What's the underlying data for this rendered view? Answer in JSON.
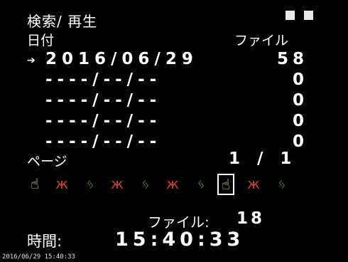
{
  "header": {
    "title": "検索/ 再生"
  },
  "window_controls": [
    "square-button",
    "square-button"
  ],
  "table": {
    "date_header": "日付",
    "file_header": "ファイル",
    "rows": [
      {
        "date": "2016/06/29",
        "count": "58",
        "selected": true
      },
      {
        "date": "----/--/--",
        "count": "0",
        "selected": false
      },
      {
        "date": "----/--/--",
        "count": "0",
        "selected": false
      },
      {
        "date": "----/--/--",
        "count": "0",
        "selected": false
      },
      {
        "date": "----/--/--",
        "count": "0",
        "selected": false
      }
    ],
    "selector_icon": "arrow-cursor-icon"
  },
  "pagination": {
    "label": "ページ",
    "value": "1 / 1"
  },
  "thumbnails": [
    {
      "icon": "hand-pointer-icon",
      "selected": false
    },
    {
      "icon": "butterfly-icon",
      "selected": false
    },
    {
      "icon": "figure-icon",
      "selected": false
    },
    {
      "icon": "butterfly-icon",
      "selected": false
    },
    {
      "icon": "figure-icon",
      "selected": false
    },
    {
      "icon": "butterfly-icon",
      "selected": false
    },
    {
      "icon": "figure-icon",
      "selected": false
    },
    {
      "icon": "hand-pointer-icon",
      "selected": true
    },
    {
      "icon": "butterfly-icon",
      "selected": false
    },
    {
      "icon": "figure-icon",
      "selected": false
    }
  ],
  "file_info": {
    "label": "ファイル:",
    "value": "18"
  },
  "time_info": {
    "label": "時間:",
    "value": "15:40:33"
  },
  "timestamp_overlay": "2016/06/29 15:40:33",
  "colors": {
    "background": "#000000",
    "text": "#ffffff",
    "butterfly": "#d04030",
    "figure": "#40a040",
    "pointer": "#ffe0a0"
  }
}
